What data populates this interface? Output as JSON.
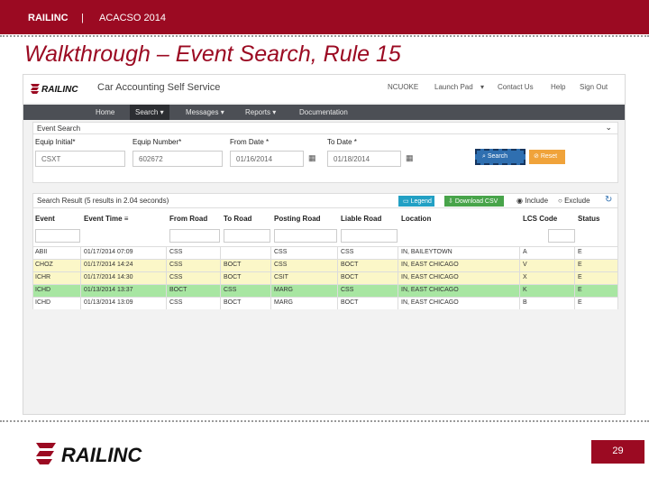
{
  "slide": {
    "org": "RAILINC",
    "separator": "|",
    "conference": "ACACSO 2014",
    "title": "Walkthrough – Event Search, Rule 15",
    "page_number": "29",
    "brand_color": "#9b0a22"
  },
  "app": {
    "name": "Car Accounting Self Service",
    "top_nav": [
      "NCUOKE",
      "Launch Pad",
      "Contact Us",
      "Help",
      "Sign Out"
    ],
    "nav": [
      {
        "label": "Home"
      },
      {
        "label": "Search",
        "active": true
      },
      {
        "label": "Messages"
      },
      {
        "label": "Reports"
      },
      {
        "label": "Documentation"
      }
    ]
  },
  "event_search": {
    "title": "Event Search",
    "fields": {
      "equip_initial": {
        "label": "Equip Initial*",
        "value": "CSXT"
      },
      "equip_number": {
        "label": "Equip Number*",
        "value": "602672"
      },
      "from_date": {
        "label": "From Date *",
        "value": "01/16/2014"
      },
      "to_date": {
        "label": "To Date *",
        "value": "01/18/2014"
      }
    },
    "search_label": "Search",
    "reset_label": "Reset"
  },
  "results": {
    "summary": "Search Result (5 results in 2.04 seconds)",
    "legend_label": "Legend",
    "csv_label": "Download CSV",
    "include_label": "Include",
    "exclude_label": "Exclude",
    "columns": [
      "Event",
      "Event Time",
      "From Road",
      "To Road",
      "Posting Road",
      "Liable Road",
      "Location",
      "LCS Code",
      "Status"
    ],
    "rows": [
      {
        "cells": [
          "ABII",
          "01/17/2014 07:09",
          "CSS",
          "",
          "CSS",
          "CSS",
          "IN, BAILEYTOWN",
          "A",
          "E"
        ],
        "color": "#ffffff"
      },
      {
        "cells": [
          "CHOZ",
          "01/17/2014 14:24",
          "CSS",
          "BOCT",
          "CSS",
          "BOCT",
          "IN, EAST CHICAGO",
          "V",
          "E"
        ],
        "color": "#fbf7c8"
      },
      {
        "cells": [
          "ICHR",
          "01/17/2014 14:30",
          "CSS",
          "BOCT",
          "CSIT",
          "BOCT",
          "IN, EAST CHICAGO",
          "X",
          "E"
        ],
        "color": "#fbf7c8"
      },
      {
        "cells": [
          "ICHD",
          "01/13/2014 13:37",
          "BOCT",
          "CSS",
          "MARG",
          "CSS",
          "IN, EAST CHICAGO",
          "K",
          "E"
        ],
        "color": "#a8e6a2"
      },
      {
        "cells": [
          "ICHD",
          "01/13/2014 13:09",
          "CSS",
          "BOCT",
          "MARG",
          "BOCT",
          "IN, EAST CHICAGO",
          "B",
          "E"
        ],
        "color": "#ffffff"
      }
    ]
  },
  "icons": {
    "calendar": "calendar-icon",
    "search": "search-icon",
    "reset": "reset-icon",
    "refresh": "refresh-icon"
  }
}
